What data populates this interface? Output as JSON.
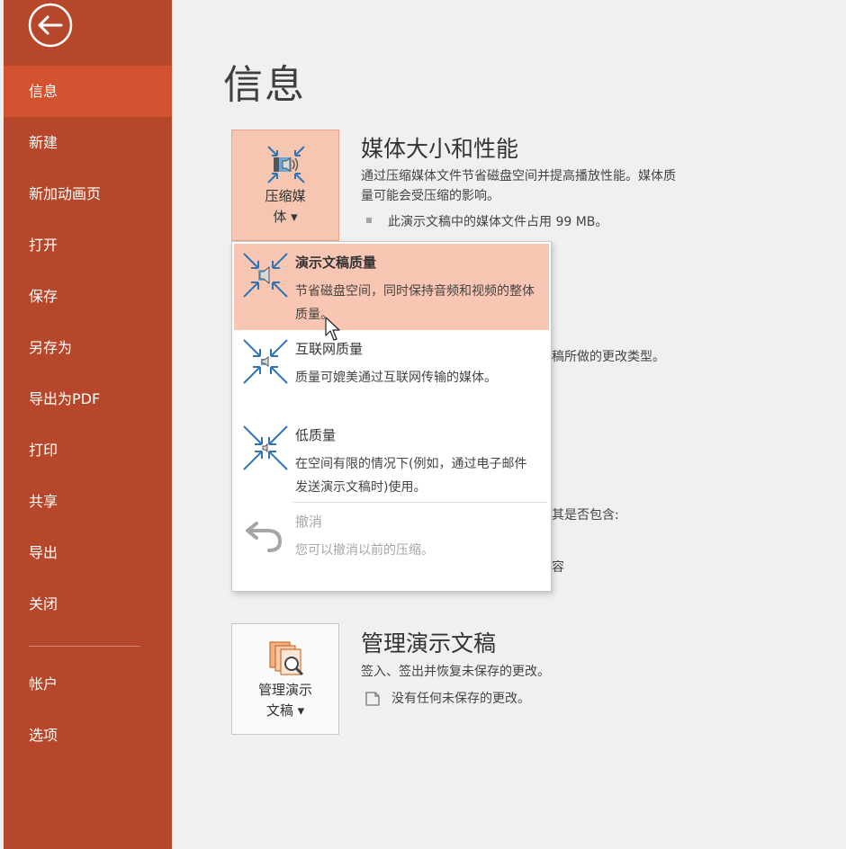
{
  "sidebar": {
    "items": [
      {
        "label": "信息"
      },
      {
        "label": "新建"
      },
      {
        "label": "新加动画页"
      },
      {
        "label": "打开"
      },
      {
        "label": "保存"
      },
      {
        "label": "另存为"
      },
      {
        "label": "导出为PDF"
      },
      {
        "label": "打印"
      },
      {
        "label": "共享"
      },
      {
        "label": "导出"
      },
      {
        "label": "关闭"
      },
      {
        "label": "帐户"
      },
      {
        "label": "选项"
      }
    ],
    "active_index": 0,
    "accent": "#b7472a",
    "active_color": "#d35230"
  },
  "page": {
    "title": "信息"
  },
  "media": {
    "button_line1": "压缩媒",
    "button_line2": "体 ▾",
    "title": "媒体大小和性能",
    "desc_line1": "通过压缩媒体文件节省磁盘空间并提高播放性能。媒体质",
    "desc_line2": "量可能会受压缩的影响。",
    "bullet": "此演示文稿中的媒体文件占用 99 MB。"
  },
  "hidden_fragments": {
    "frag1": "稿所做的更改类型。",
    "frag2": "其是否包含:",
    "frag3": "容"
  },
  "compress_menu": {
    "items": [
      {
        "title": "演示文稿质量",
        "desc": "节省磁盘空间，同时保持音频和视频的整体质量。"
      },
      {
        "title": "互联网质量",
        "desc": "质量可媲美通过互联网传输的媒体。"
      },
      {
        "title": "低质量",
        "desc": "在空间有限的情况下(例如，通过电子邮件发送演示文稿时)使用。"
      },
      {
        "title": "撤消",
        "desc": "您可以撤消以前的压缩。"
      }
    ]
  },
  "manage": {
    "button_line1": "管理演示",
    "button_line2": "文稿 ▾",
    "title": "管理演示文稿",
    "desc": "签入、签出并恢复未保存的更改。",
    "status": "没有任何未保存的更改。"
  }
}
